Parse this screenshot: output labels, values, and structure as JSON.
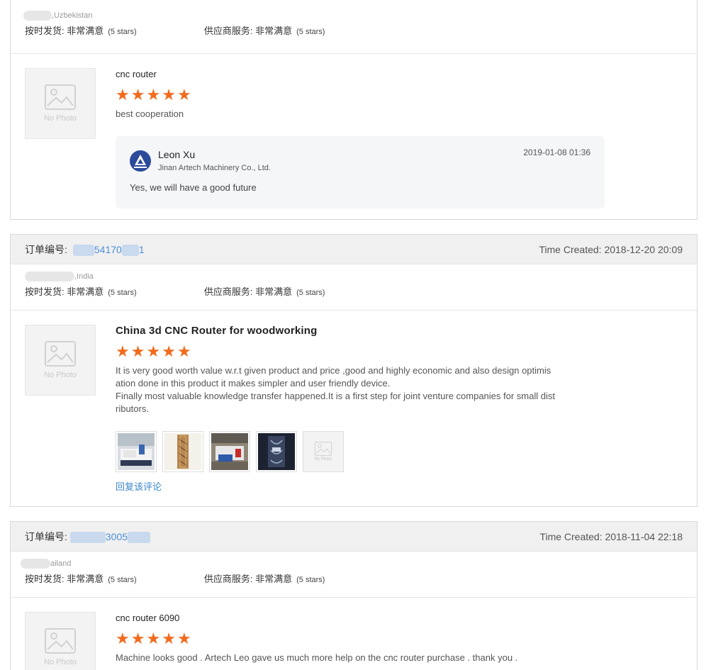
{
  "labels": {
    "order_no": "订单编号:",
    "time_created": "Time Created:",
    "on_time_delivery": "按时发货:",
    "supplier_service": "供应商服务:",
    "very_satisfied": "非常满意",
    "five_stars": "(5 stars)",
    "no_photo": "No Photo",
    "reply_link": "回复该评论"
  },
  "reviews": [
    {
      "country": ",Uzbekistan",
      "product": "cnc router",
      "rating": 5,
      "comment": "best cooperation",
      "reply": {
        "name": "Leon Xu",
        "company": "Jinan Artech Machinery Co., Ltd.",
        "time": "2019-01-08 01:36",
        "text": "Yes, we will have a good future"
      }
    },
    {
      "order_fragment": "54170",
      "order_fragment_end": "1",
      "time_created": "2018-12-20 20:09",
      "country": ",India",
      "product": "China 3d CNC Router for woodworking",
      "rating": 5,
      "comment_lines": [
        "It is very good worth value w.r.t given product and price ,good and highly economic and also design optimis",
        "ation done in this product it makes simpler and user friendly device.",
        "Finally most valuable knowledge transfer happened.It is a first step for joint venture companies for small dist",
        "ributors."
      ],
      "photos": [
        "cnc-machine-photo",
        "wood-panel-photo",
        "workshop-photo",
        "carved-panel-photo",
        "no-photo"
      ]
    },
    {
      "order_fragment": "3005",
      "time_created": "2018-11-04 22:18",
      "country": "ailand",
      "product": "cnc router 6090",
      "rating": 5,
      "comment": "Machine looks good . Artech Leo gave us much more help on the cnc router purchase . thank you ."
    }
  ],
  "colors": {
    "star": "#f26b1d",
    "link": "#3a86c8",
    "header_bg": "#f0f0f0"
  }
}
